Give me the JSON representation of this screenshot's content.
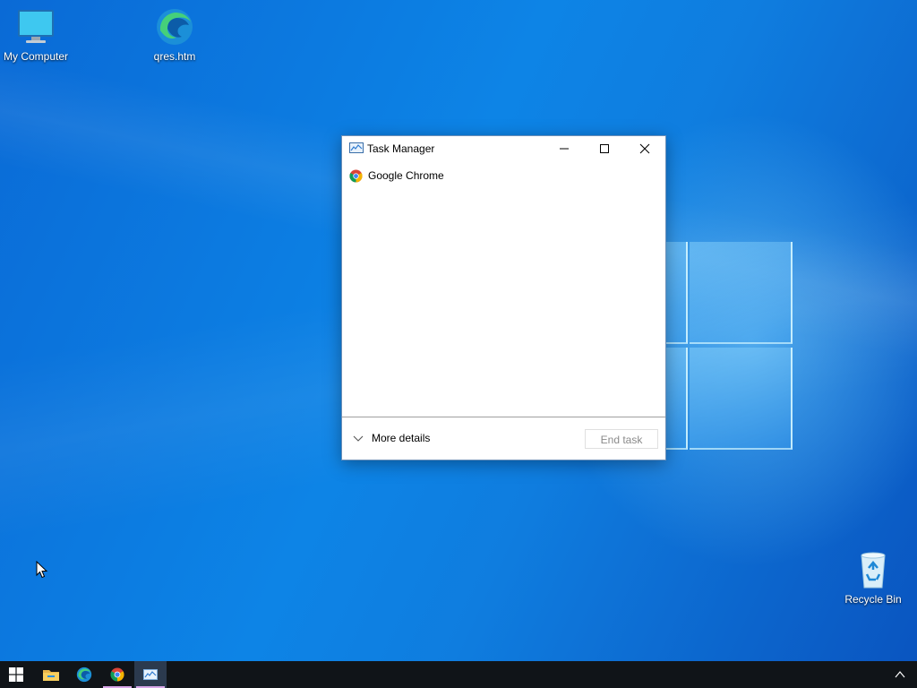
{
  "desktop": {
    "icons": [
      {
        "label": "My Computer",
        "icon": "computer-icon"
      },
      {
        "label": "qres.htm",
        "icon": "edge-icon"
      },
      {
        "label": "Recycle Bin",
        "icon": "recycle-bin-icon"
      }
    ]
  },
  "task_manager": {
    "title": "Task Manager",
    "processes": [
      {
        "name": "Google Chrome",
        "icon": "chrome-icon"
      }
    ],
    "more_details_label": "More details",
    "end_task_label": "End task"
  },
  "taskbar": {
    "items": [
      {
        "name": "start",
        "icon": "windows-logo-icon"
      },
      {
        "name": "file-explorer",
        "icon": "folder-icon"
      },
      {
        "name": "edge",
        "icon": "edge-icon"
      },
      {
        "name": "chrome",
        "icon": "chrome-icon"
      },
      {
        "name": "task-manager",
        "icon": "task-manager-icon"
      }
    ]
  },
  "colors": {
    "desktop_blue": "#0d84e6",
    "taskbar": "#101418",
    "active_underline": "#d9a7e8"
  }
}
